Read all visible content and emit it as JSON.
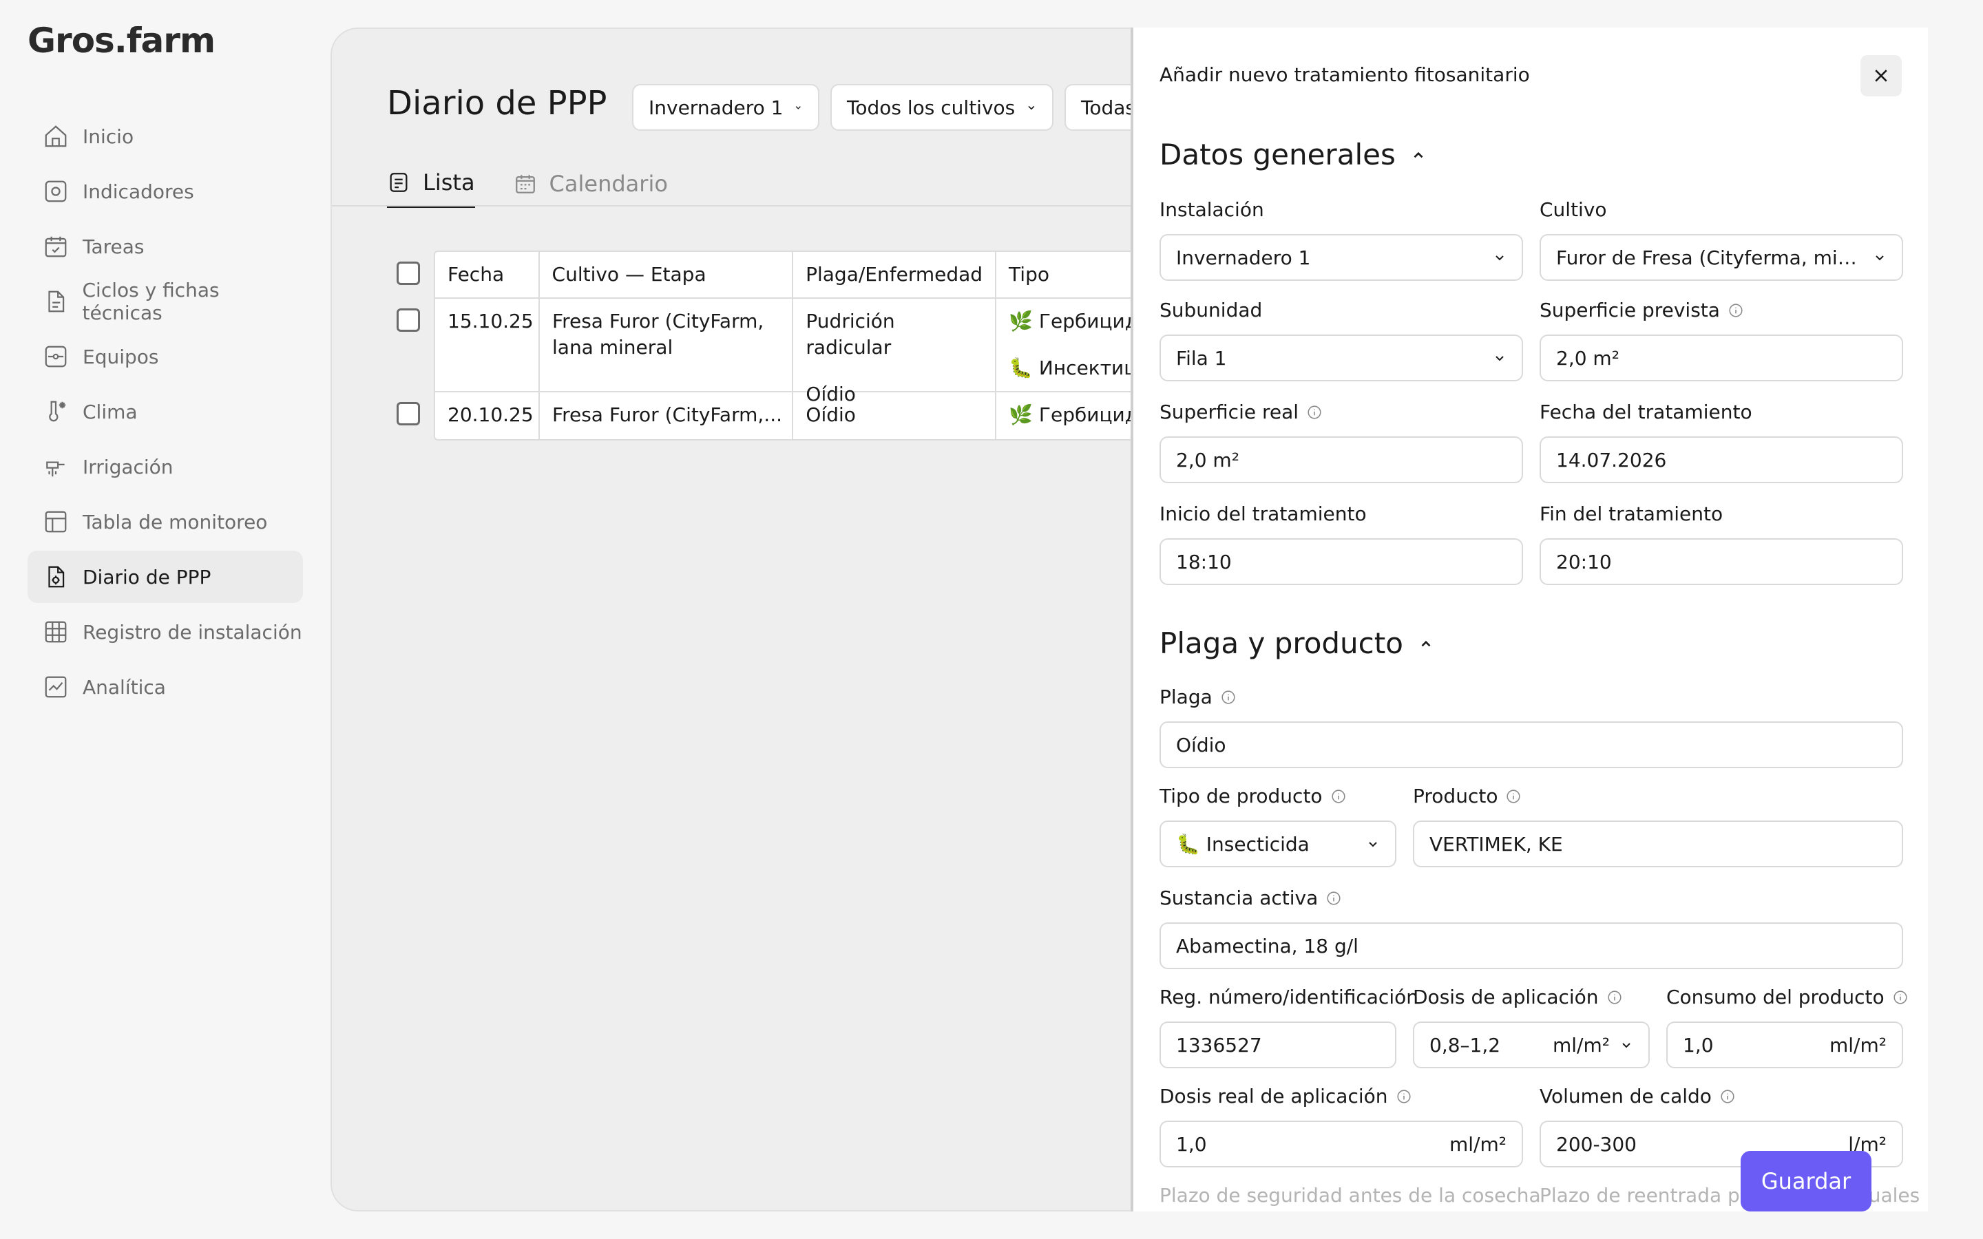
{
  "app": {
    "logo": "Gros.farm"
  },
  "sidebar": {
    "items": [
      {
        "label": "Inicio"
      },
      {
        "label": "Indicadores"
      },
      {
        "label": "Tareas"
      },
      {
        "label": "Ciclos y fichas técnicas"
      },
      {
        "label": "Equipos"
      },
      {
        "label": "Clima"
      },
      {
        "label": "Irrigación"
      },
      {
        "label": "Tabla de monitoreo"
      },
      {
        "label": "Diario de PPP"
      },
      {
        "label": "Registro de instalación"
      },
      {
        "label": "Analítica"
      }
    ]
  },
  "main": {
    "title": "Diario de PPP",
    "filters": [
      "Invernadero 1",
      "Todos los cultivos",
      "Todas"
    ],
    "tabs": [
      {
        "label": "Lista"
      },
      {
        "label": "Calendario"
      }
    ],
    "table": {
      "headers": [
        "Fecha",
        "Cultivo — Etapa",
        "Plaga/Enfermedad",
        "Tipo"
      ],
      "rows": [
        {
          "date": "15.10.25",
          "crop": "Fresa Furor (CityFarm, lana mineral",
          "pest1": "Pudrición radicular",
          "type1": "🌿 Гербицид",
          "pest2": "Oídio",
          "type2": "🐛 Инсектицид"
        },
        {
          "date": "20.10.25",
          "crop": "Fresa Furor (CityFarm,...",
          "pest1": "Oídio",
          "type1": "🌿 Гербицид"
        }
      ]
    }
  },
  "panel": {
    "title": "Añadir nuevo tratamiento fitosanitario",
    "general": {
      "title": "Datos generales",
      "instalacion_label": "Instalación",
      "instalacion": "Invernadero 1",
      "cultivo_label": "Cultivo",
      "cultivo": "Furor de Fresa (Cityferma, mine...",
      "subunidad_label": "Subunidad",
      "subunidad": "Fila 1",
      "superficie_prevista_label": "Superficie prevista",
      "superficie_prevista": "2,0 m²",
      "superficie_real_label": "Superficie real",
      "superficie_real": "2,0 m²",
      "fecha_label": "Fecha del tratamiento",
      "fecha": "14.07.2026",
      "inicio_label": "Inicio del tratamiento",
      "inicio": "18:10",
      "fin_label": "Fin del tratamiento",
      "fin": "20:10"
    },
    "pest": {
      "title": "Plaga y producto",
      "plaga_label": "Plaga",
      "plaga": "Oídio",
      "tipo_label": "Tipo de producto",
      "tipo": "🐛 Insecticida",
      "producto_label": "Producto",
      "producto": "VERTIMEK, KE",
      "sustancia_label": "Sustancia activa",
      "sustancia": "Abamectina, 18 g/l",
      "reg_label": "Reg. número/identificación",
      "reg": "1336527",
      "dosis_label": "Dosis de aplicación",
      "dosis": "0,8–1,2",
      "dosis_unit": "ml/m²",
      "consumo_label": "Consumo del producto",
      "consumo": "1,0",
      "consumo_unit": "ml/m²",
      "dosis_real_label": "Dosis real de aplicación",
      "dosis_real": "1,0",
      "dosis_real_unit": "ml/m²",
      "volumen_label": "Volumen de caldo",
      "volumen": "200-300",
      "volumen_unit": "l/m²",
      "plazo_seguridad_label": "Plazo de seguridad antes de la cosecha",
      "plazo_reentrada_label": "Plazo de reentrada par",
      "manuales_label": "nuales"
    },
    "save_label": "Guardar"
  },
  "colors": {
    "accent": "#6a5cf5",
    "active_nav": "#ebebeb"
  }
}
